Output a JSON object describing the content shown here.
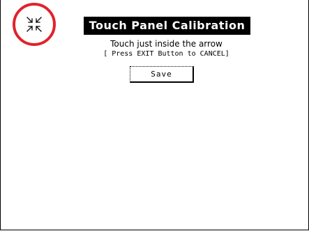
{
  "screen": {
    "title": "Touch Panel Calibration",
    "instruction": "Touch just inside the arrow",
    "cancel_hint": "[ Press EXIT Button to CANCEL]",
    "save_label": "Save"
  },
  "target": {
    "icon": "calibration-arrows-icon",
    "highlight_color": "#e0232a"
  }
}
